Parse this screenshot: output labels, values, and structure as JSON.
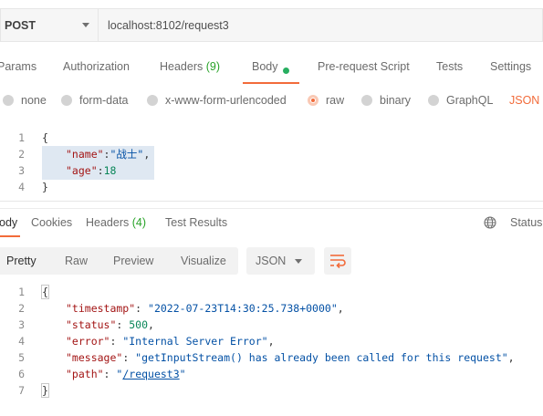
{
  "request": {
    "method": "POST",
    "url": "localhost:8102/request3"
  },
  "request_tabs": {
    "params": "Params",
    "authorization": "Authorization",
    "headers": "Headers",
    "headers_count": "(9)",
    "body": "Body",
    "prerequest": "Pre-request Script",
    "tests": "Tests",
    "settings": "Settings"
  },
  "body_types": {
    "none": "none",
    "form_data": "form-data",
    "urlencoded": "x-www-form-urlencoded",
    "raw": "raw",
    "binary": "binary",
    "graphql": "GraphQL",
    "json": "JSON",
    "selected": "raw"
  },
  "request_body": {
    "lines": [
      "1",
      "2",
      "3",
      "4"
    ],
    "open": "{",
    "name_key": "\"name\"",
    "name_value": "\"战士\"",
    "age_key": "\"age\"",
    "age_value": "18",
    "close": "}"
  },
  "response_tabs": {
    "body": "ody",
    "cookies": "Cookies",
    "headers": "Headers",
    "headers_count": "(4)",
    "test_results": "Test Results",
    "status": "Status:"
  },
  "response_toolbar": {
    "pretty": "Pretty",
    "raw": "Raw",
    "preview": "Preview",
    "visualize": "Visualize",
    "format": "JSON"
  },
  "response_body": {
    "lines": [
      "1",
      "2",
      "3",
      "4",
      "5",
      "6",
      "7"
    ],
    "open": "{",
    "timestamp_key": "\"timestamp\"",
    "timestamp_value": "\"2022-07-23T14:30:25.738+0000\"",
    "status_key": "\"status\"",
    "status_value": "500",
    "error_key": "\"error\"",
    "error_value": "\"Internal Server Error\"",
    "message_key": "\"message\"",
    "message_value": "\"getInputStream() has already been called for this request\"",
    "path_key": "\"path\"",
    "path_value": "/request3",
    "close": "}"
  },
  "colors": {
    "accent": "#f26b3a",
    "count_green": "#29a329",
    "string_blue": "#0451a5",
    "key_red": "#a31515",
    "number_green": "#098658"
  }
}
